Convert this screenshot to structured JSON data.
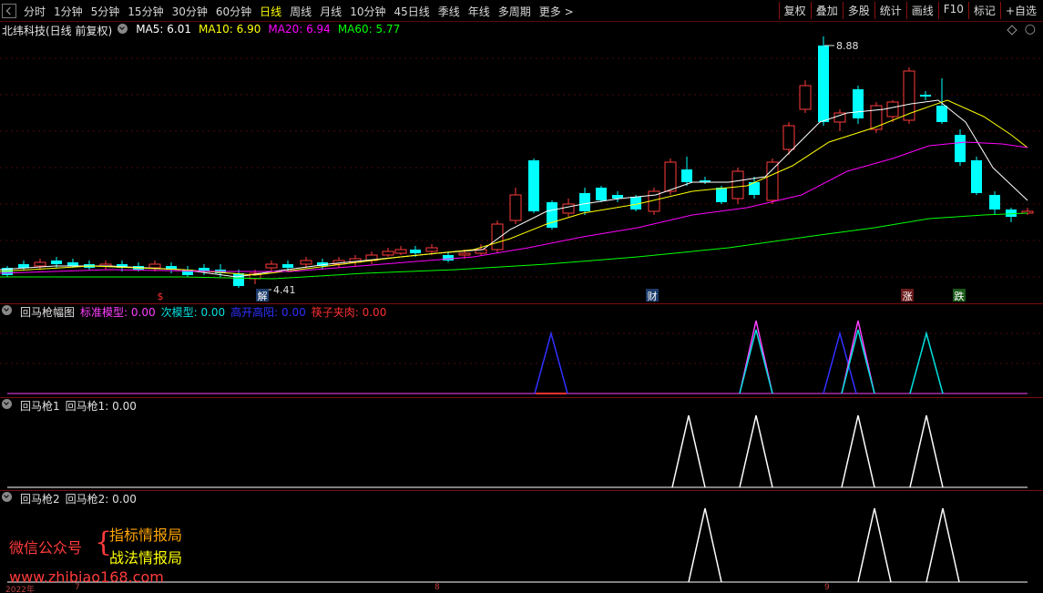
{
  "toolbar": {
    "periods": [
      "分时",
      "1分钟",
      "5分钟",
      "15分钟",
      "30分钟",
      "60分钟",
      "日线",
      "周线",
      "月线",
      "10分钟",
      "45日线",
      "季线",
      "年线",
      "多周期",
      "更多 >"
    ],
    "active": "日线",
    "right_buttons": [
      "复权",
      "叠加",
      "多股",
      "统计",
      "画线",
      "F10",
      "标记",
      "+自选"
    ]
  },
  "main": {
    "stock": "北纬科技(日线 前复权)",
    "ma": [
      {
        "label": "MA5: 6.01",
        "color": "#ffffff"
      },
      {
        "label": "MA10: 6.90",
        "color": "#ffff00"
      },
      {
        "label": "MA20: 6.94",
        "color": "#ff00ff"
      },
      {
        "label": "MA60: 5.77",
        "color": "#00ff00"
      }
    ],
    "high_label": "8.88",
    "low_label": "4.41",
    "markers": [
      {
        "text": "$",
        "color": "#ff3030"
      },
      {
        "text": "解",
        "color": "#ffffff"
      },
      {
        "text": "财",
        "color": "#ffffff"
      },
      {
        "text": "涨",
        "color": "#ffffff"
      },
      {
        "text": "跌",
        "color": "#ffffff"
      }
    ]
  },
  "ind1": {
    "title": "回马枪幅图",
    "fields": [
      {
        "label": "标准模型: 0.00",
        "color": "#ff40ff"
      },
      {
        "label": "次模型: 0.00",
        "color": "#00e0e0"
      },
      {
        "label": "高开高阳: 0.00",
        "color": "#3030ff"
      },
      {
        "label": "筷子夹肉: 0.00",
        "color": "#ff3030"
      }
    ]
  },
  "ind2": {
    "title": "回马枪1",
    "field": "回马枪1: 0.00"
  },
  "ind3": {
    "title": "回马枪2",
    "field": "回马枪2: 0.00"
  },
  "ad": {
    "wechat": "微信公众号",
    "line1": "指标情报局",
    "line2": "战法情报局",
    "url": "www.zhibiao168.com"
  },
  "axis": {
    "dates": [
      "2022年",
      "7",
      "8",
      "9"
    ]
  },
  "colors": {
    "up": "#ff3b3b",
    "down": "#00ffff",
    "ma5": "#ffffff",
    "ma10": "#ffff00",
    "ma20": "#ff00ff",
    "ma60": "#00ff00"
  }
}
